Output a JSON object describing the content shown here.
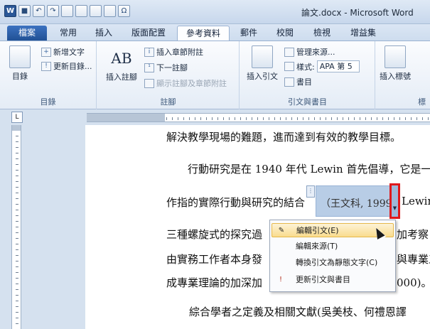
{
  "window": {
    "title": "論文.docx - Microsoft Word",
    "app_icon": "W"
  },
  "qat": {
    "save": "■",
    "undo": "↶",
    "redo": "↷"
  },
  "tabs": [
    {
      "label": "檔案"
    },
    {
      "label": "常用"
    },
    {
      "label": "插入"
    },
    {
      "label": "版面配置"
    },
    {
      "label": "參考資料"
    },
    {
      "label": "郵件"
    },
    {
      "label": "校閱"
    },
    {
      "label": "檢視"
    },
    {
      "label": "增益集"
    }
  ],
  "ribbon": {
    "toc": {
      "label": "目錄",
      "add_text": "新增文字",
      "update": "更新目錄...",
      "group": "目錄"
    },
    "footnotes": {
      "insert_footnote": "插入註腳",
      "insert_endnote": "插入章節附註",
      "next_footnote": "下一註腳",
      "show_notes": "顯示註腳及章節附註",
      "group": "註腳",
      "ab_icon": "AB"
    },
    "citations": {
      "insert_citation": "插入引文",
      "manage_sources": "管理來源...",
      "style_label": "樣式:",
      "style_value": "APA 第 5",
      "bibliography": "書目",
      "group": "引文與書目"
    },
    "captions": {
      "insert_caption": "插入標號",
      "group": "標"
    }
  },
  "document": {
    "lines": [
      "解決教學現場的難題，進而達到有效的教學目標。",
      "行動研究是在 1940 年代 Lewin 首先倡導，它是一",
      "作指的實際行動與研究的結合",
      "Lewin",
      "三種螺旋式的探究過",
      "加考察",
      "由實務工作者本身發",
      "與專業工",
      "成專業理論的加深加",
      "000)。",
      "綜合學者之定義及相關文獻(吳美枝、何禮恩譯"
    ],
    "citation": "（王文科, 1999）"
  },
  "context_menu": {
    "items": [
      {
        "label": "編輯引文(E)"
      },
      {
        "label": "編輯來源(T)"
      },
      {
        "label": "轉換引文為靜態文字(C)"
      },
      {
        "label": "更新引文與書目"
      }
    ]
  }
}
